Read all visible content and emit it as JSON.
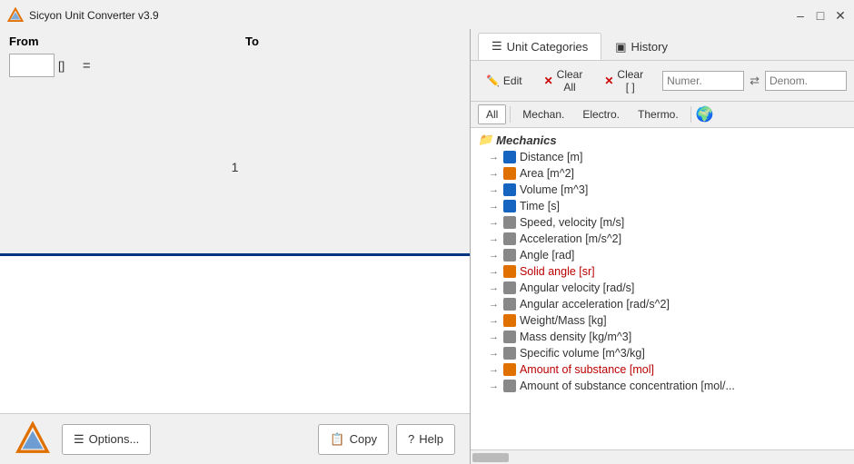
{
  "titlebar": {
    "title": "Sicyon Unit Converter v3.9",
    "min_btn": "–",
    "max_btn": "□",
    "close_btn": "✕"
  },
  "converter": {
    "from_label": "From",
    "to_label": "To",
    "input_value": "",
    "unit_from": "[]",
    "equals": "=",
    "result": "1"
  },
  "bottom_bar": {
    "options_label": "Options...",
    "copy_label": "Copy",
    "help_label": "Help"
  },
  "right_panel": {
    "tabs": [
      {
        "id": "unit-categories",
        "label": "Unit Categories",
        "active": true
      },
      {
        "id": "history",
        "label": "History",
        "active": false
      }
    ],
    "toolbar": {
      "edit_label": "Edit",
      "clear_all_label": "Clear All",
      "clear_brackets_label": "Clear [ ]",
      "numer_placeholder": "Numer.",
      "denom_placeholder": "Denom."
    },
    "filter_tabs": [
      "All",
      "Mechan.",
      "Electro.",
      "Thermo."
    ],
    "active_filter": "All",
    "tree": {
      "group": "Mechanics",
      "items": [
        {
          "label": "Distance [m]",
          "color": "blue",
          "highlighted": false
        },
        {
          "label": "Area [m^2]",
          "color": "orange",
          "highlighted": false
        },
        {
          "label": "Volume [m^3]",
          "color": "blue",
          "highlighted": false
        },
        {
          "label": "Time [s]",
          "color": "blue",
          "highlighted": false
        },
        {
          "label": "Speed, velocity [m/s]",
          "color": "gray",
          "highlighted": false
        },
        {
          "label": "Acceleration [m/s^2]",
          "color": "gray",
          "highlighted": false
        },
        {
          "label": "Angle [rad]",
          "color": "gray",
          "highlighted": false
        },
        {
          "label": "Solid angle [sr]",
          "color": "orange",
          "highlighted": true
        },
        {
          "label": "Angular velocity [rad/s]",
          "color": "gray",
          "highlighted": false
        },
        {
          "label": "Angular acceleration [rad/s^2]",
          "color": "gray",
          "highlighted": false
        },
        {
          "label": "Weight/Mass [kg]",
          "color": "orange",
          "highlighted": false
        },
        {
          "label": "Mass density [kg/m^3]",
          "color": "gray",
          "highlighted": false
        },
        {
          "label": "Specific volume [m^3/kg]",
          "color": "gray",
          "highlighted": false
        },
        {
          "label": "Amount of substance [mol]",
          "color": "orange",
          "highlighted": true
        },
        {
          "label": "Amount of substance concentration [mol/...",
          "color": "gray",
          "highlighted": false
        }
      ]
    }
  }
}
